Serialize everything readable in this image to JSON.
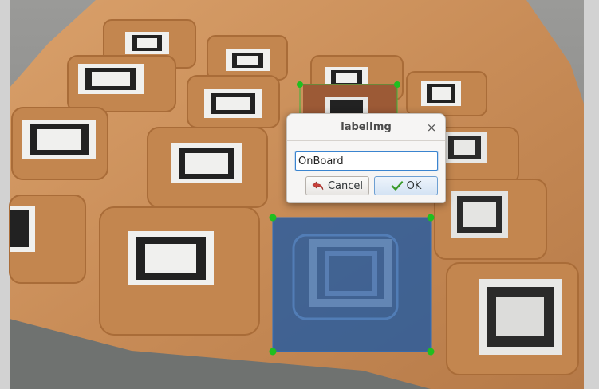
{
  "app": {
    "title": "labelImg"
  },
  "dialog": {
    "title": "labelImg",
    "close_glyph": "×",
    "input_value": "OnBoard",
    "cancel_label": "Cancel",
    "cancel_icon": "undo-arrow-icon",
    "ok_label": "OK",
    "ok_icon": "checkmark-icon"
  },
  "annotations": [
    {
      "state": "selected",
      "color": "#1e5aa8"
    },
    {
      "state": "unselected",
      "color": "#3cb43c"
    }
  ],
  "colors": {
    "handle": "#1fbf1f",
    "selected_fill": "#1c58a4",
    "background": "#d2d2d2"
  }
}
